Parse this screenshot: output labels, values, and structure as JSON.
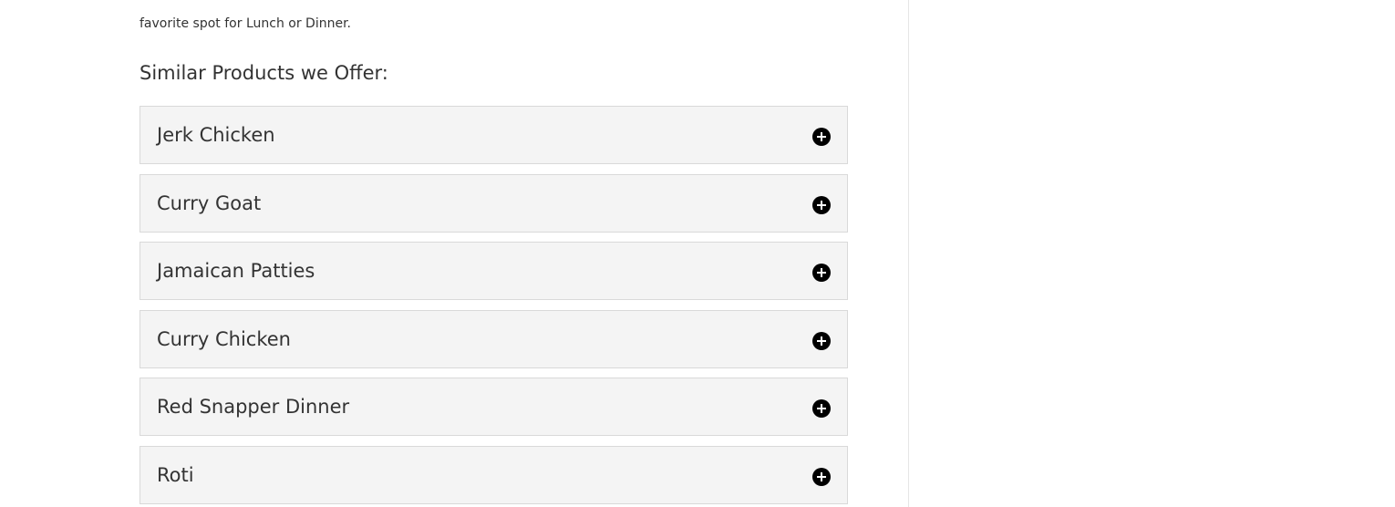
{
  "intro": {
    "text": "favorite spot for Lunch or Dinner."
  },
  "similar": {
    "title": "Similar Products we Offer:",
    "items": [
      {
        "label": "Jerk Chicken",
        "icon": "plus-circle-icon"
      },
      {
        "label": "Curry Goat",
        "icon": "plus-circle-icon"
      },
      {
        "label": "Jamaican Patties",
        "icon": "plus-circle-icon"
      },
      {
        "label": "Curry Chicken",
        "icon": "plus-circle-icon"
      },
      {
        "label": "Red Snapper Dinner",
        "icon": "plus-circle-icon"
      },
      {
        "label": "Roti",
        "icon": "plus-circle-icon"
      }
    ]
  },
  "colors": {
    "accordion_bg": "#f4f4f4",
    "accordion_border": "#d9d9d9",
    "text": "#333333",
    "icon": "#000000"
  }
}
